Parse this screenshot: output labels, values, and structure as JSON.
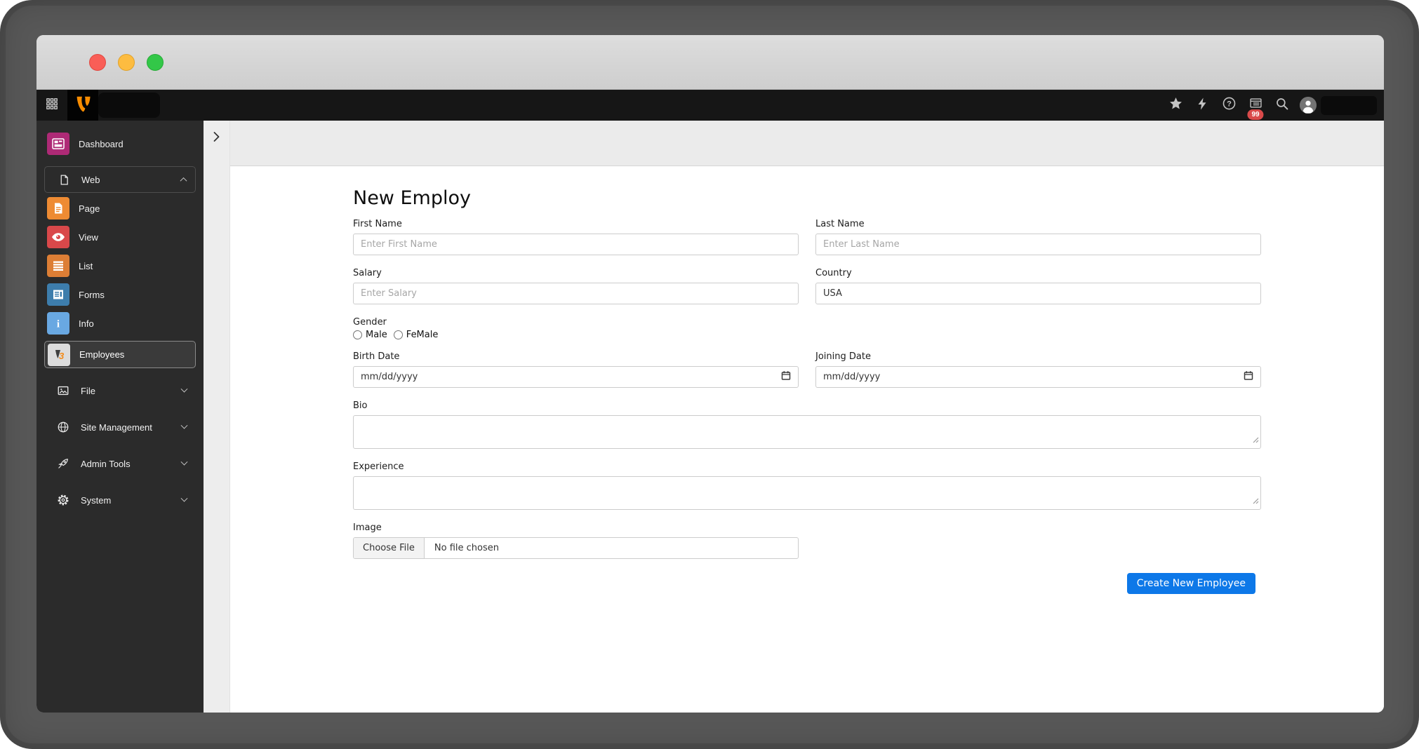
{
  "titlebar": {
    "controls": [
      "close",
      "minimize",
      "maximize"
    ]
  },
  "topbar": {
    "badge_count": "99",
    "icons": [
      "module-menu-grid",
      "typo3-logo",
      "bookmarks-star",
      "clear-cache-bolt",
      "help",
      "reports",
      "search",
      "avatar"
    ]
  },
  "sidebar": {
    "items": [
      {
        "label": "Dashboard",
        "type": "module"
      },
      {
        "label": "Web",
        "type": "group-expanded"
      },
      {
        "label": "Page",
        "type": "module"
      },
      {
        "label": "View",
        "type": "module"
      },
      {
        "label": "List",
        "type": "module"
      },
      {
        "label": "Forms",
        "type": "module"
      },
      {
        "label": "Info",
        "type": "module"
      },
      {
        "label": "Employees",
        "type": "module-selected"
      },
      {
        "label": "File",
        "type": "group-collapsed"
      },
      {
        "label": "Site Management",
        "type": "group-collapsed"
      },
      {
        "label": "Admin Tools",
        "type": "group-collapsed"
      },
      {
        "label": "System",
        "type": "group-collapsed"
      }
    ]
  },
  "content": {
    "title": "New Employ",
    "fields": {
      "first_name": {
        "label": "First Name",
        "placeholder": "Enter First Name"
      },
      "last_name": {
        "label": "Last Name",
        "placeholder": "Enter Last Name"
      },
      "salary": {
        "label": "Salary",
        "placeholder": "Enter Salary"
      },
      "country": {
        "label": "Country",
        "value": "USA"
      },
      "gender": {
        "label": "Gender",
        "options": [
          "Male",
          "FeMale"
        ]
      },
      "birth_date": {
        "label": "Birth Date",
        "value": "mm/dd/yyyy"
      },
      "joining_date": {
        "label": "Joining Date",
        "value": "mm/dd/yyyy"
      },
      "bio": {
        "label": "Bio",
        "value": ""
      },
      "experience": {
        "label": "Experience",
        "value": ""
      },
      "image": {
        "label": "Image",
        "button_label": "Choose File",
        "status": "No file chosen"
      }
    },
    "submit_label": "Create New Employee"
  },
  "colors": {
    "accent_button": "#0d78e8",
    "badge": "#d94a4a",
    "topbar_bg": "#161616",
    "sidebar_bg": "#2b2b2b",
    "tile_dashboard": "#ae2a76",
    "tile_page": "#ee8b33",
    "tile_view": "#d9484a",
    "tile_list": "#dd7e35",
    "tile_forms": "#3d7dac",
    "tile_info": "#69a8e2",
    "tile_employees_bg": "#dcdcdc",
    "typo3_orange": "#f88c00",
    "traffic_close": "#f95e57",
    "traffic_minimize": "#fdbc40",
    "traffic_maximize": "#33c748"
  }
}
